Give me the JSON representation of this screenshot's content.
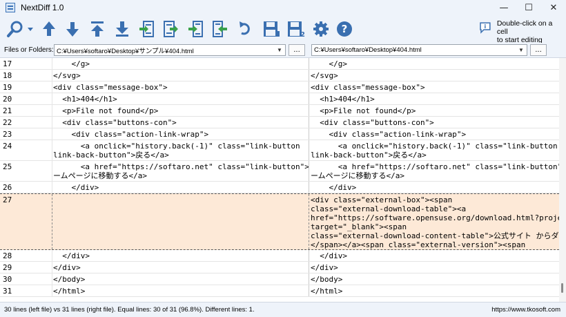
{
  "window": {
    "title": "NextDiff 1.0",
    "controls": {
      "minimize": "—",
      "maximize": "☐",
      "close": "✕"
    }
  },
  "toolbar": {
    "icons": [
      "search-icon",
      "move-up-icon",
      "move-down-icon",
      "move-top-icon",
      "move-bottom-icon",
      "copy-left-to-right-icon",
      "copy-right-to-left-icon",
      "copy-all-left-icon",
      "copy-all-right-icon",
      "undo-icon",
      "save-left-icon",
      "save-right-icon",
      "settings-icon",
      "help-icon"
    ],
    "save_right_badge": "2",
    "help_glyph": "?",
    "hint_text": [
      "Double-click on a cell",
      "to start editing"
    ]
  },
  "files": {
    "label": "Files or Folders:",
    "left_path": "C:¥Users¥softaro¥Desktop¥サンプル¥404.html",
    "right_path": "C:¥Users¥softaro¥Desktop¥404.html",
    "browse_label": "..."
  },
  "rows": [
    {
      "num": "17",
      "left": [
        "    </g>"
      ],
      "right": [
        "    </g>"
      ]
    },
    {
      "num": "18",
      "left": [
        "</svg>"
      ],
      "right": [
        "</svg>"
      ]
    },
    {
      "num": "19",
      "left": [
        "<div class=\"message-box\">"
      ],
      "right": [
        "<div class=\"message-box\">"
      ]
    },
    {
      "num": "20",
      "left": [
        "  <h1>404</h1>"
      ],
      "right": [
        "  <h1>404</h1>"
      ]
    },
    {
      "num": "21",
      "left": [
        "  <p>File not found</p>"
      ],
      "right": [
        "  <p>File not found</p>"
      ]
    },
    {
      "num": "22",
      "left": [
        "  <div class=\"buttons-con\">"
      ],
      "right": [
        "  <div class=\"buttons-con\">"
      ]
    },
    {
      "num": "23",
      "left": [
        "    <div class=\"action-link-wrap\">"
      ],
      "right": [
        "    <div class=\"action-link-wrap\">"
      ]
    },
    {
      "num": "24",
      "left": [
        "      <a onclick=\"history.back(-1)\" class=\"link-button",
        "link-back-button\">戻る</a>"
      ],
      "right": [
        "      <a onclick=\"history.back(-1)\" class=\"link-button",
        "link-back-button\">戻る</a>"
      ]
    },
    {
      "num": "25",
      "left": [
        "      <a href=\"https://softaro.net\" class=\"link-button\">ホ",
        "ームページに移動する</a>"
      ],
      "right": [
        "      <a href=\"https://softaro.net\" class=\"link-button\">ホ",
        "ームページに移動する</a>"
      ]
    },
    {
      "num": "26",
      "left": [
        "    </div>"
      ],
      "right": [
        "    </div>"
      ]
    },
    {
      "num": "27",
      "left": [
        ""
      ],
      "right": [
        "<div class=\"external-box\"><span",
        "class=\"external-download-table\"><a",
        "href=\"https://software.opensuse.org/download.html?proje",
        "target=\"_blank\"><span",
        "class=\"external-download-content-table\">公式サイト からダウンロ",
        "</span></a><span class=\"external-version\"><span"
      ]
    },
    {
      "num": "28",
      "left": [
        "  </div>"
      ],
      "right": [
        "  </div>"
      ]
    },
    {
      "num": "29",
      "left": [
        "</div>"
      ],
      "right": [
        "</div>"
      ]
    },
    {
      "num": "30",
      "left": [
        "</body>"
      ],
      "right": [
        "</body>"
      ]
    },
    {
      "num": "31",
      "left": [
        "</html>"
      ],
      "right": [
        "</html>"
      ]
    }
  ],
  "status": {
    "summary": "30 lines (left file) vs 31 lines (right file). Equal lines: 30 of 31 (96.8%). Different lines: 1.",
    "url": "https://www.tkosoft.com"
  },
  "colors": {
    "toolbar_icon_blue": "#3a6fb0",
    "toolbar_icon_green": "#3aa14a",
    "changed_row_bg": "#fde9d7"
  }
}
